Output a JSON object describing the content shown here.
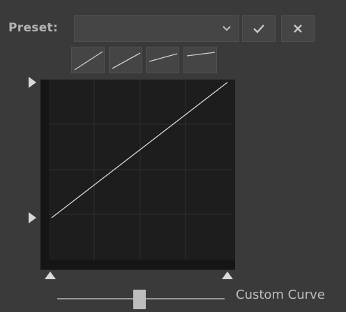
{
  "preset": {
    "label": "Preset:",
    "selected_value": "",
    "chevron_icon": "chevron-down-icon",
    "apply_icon": "checkmark-icon",
    "cancel_icon": "close-icon"
  },
  "curve_presets": [
    {
      "name": "curve-preset-1"
    },
    {
      "name": "curve-preset-2"
    },
    {
      "name": "curve-preset-3"
    },
    {
      "name": "curve-preset-4"
    }
  ],
  "slider": {
    "label": "Custom Curve",
    "value_fraction": 0.5
  },
  "colors": {
    "panel_bg": "#3a3a3a",
    "graph_bg": "#1d1d1d",
    "grid": "#2f2f2f",
    "curve": "#d8d8d8",
    "marker": "#d9d9d9"
  }
}
